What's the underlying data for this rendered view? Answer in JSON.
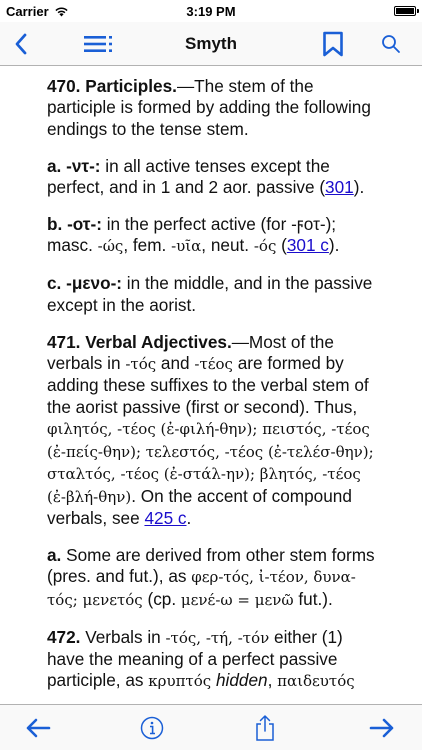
{
  "status": {
    "carrier": "Carrier",
    "time": "3:19 PM",
    "battery_level": 1.0
  },
  "nav": {
    "title": "Smyth",
    "back_icon": "chevron-left-icon",
    "toc_icon": "list-icon",
    "bookmark_icon": "bookmark-icon",
    "search_icon": "search-icon"
  },
  "colors": {
    "accent": "#1a5fd6",
    "link": "#1a0dcc"
  },
  "content": {
    "p470": {
      "head": "470. Participles.",
      "text": "—The stem of the participle is formed by adding the following endings to the tense stem."
    },
    "p470a": {
      "label": "a.",
      "ending": "-ντ-:",
      "text1": " in all active tenses except the perfect, and in 1 and 2 aor. passive (",
      "link": "301",
      "text2": ")."
    },
    "p470b": {
      "label": "b.",
      "ending": "-οτ-:",
      "text1": " in the perfect active (for -ϝοτ-); masc. ",
      "g1": "-ώς",
      "text2": ", fem. ",
      "g2": "-υῖα",
      "text3": ", neut. ",
      "g3": "-ός",
      "text4": " (",
      "link": "301 c",
      "text5": ")."
    },
    "p470c": {
      "label": "c.",
      "ending": "-μενο-:",
      "text": " in the middle, and in the passive except in the aorist."
    },
    "p471": {
      "head": "471. Verbal Adjectives.",
      "t1": "—Most of the verbals in ",
      "g1": "-τός",
      "t2": " and ",
      "g2": "-τέος",
      "t3": " are formed by adding these suffixes to the verbal stem of the aorist passive (first or second). Thus, ",
      "g3": "φιλητός, -τέος (ἐ-φιλή-θην); πειστός, -τέος (ἐ-πείς-θην); τελεστός, -τέος (ἐ-τελέσ-θην); σταλτός, -τέος (ἐ-στάλ-ην); βλητός, -τέος (ἐ-βλή-θην)",
      "t4": ". On the accent of compound verbals, see ",
      "link": "425 c",
      "t5": "."
    },
    "p471a": {
      "label": "a.",
      "t1": " Some are derived from other stem forms (pres. and fut.), as ",
      "g1": "φερ-τός, ἰ-τέον, δυνα-τός; μενετός",
      "t2": " (cp. ",
      "g2": "μενέ-ω = μενῶ",
      "t3": " fut.)."
    },
    "p472": {
      "head": "472.",
      "t1": " Verbals in ",
      "g1": "-τός, -τή, -τόν",
      "t2": " either (1) have the meaning of a perfect passive participle, as ",
      "g2": "κρυπτός",
      "t3": " ",
      "i1": "hidden",
      "t4": ", ",
      "g3": "παιδευτός"
    }
  },
  "toolbar": {
    "prev_icon": "arrow-left-icon",
    "info_icon": "info-icon",
    "share_icon": "share-icon",
    "next_icon": "arrow-right-icon"
  }
}
